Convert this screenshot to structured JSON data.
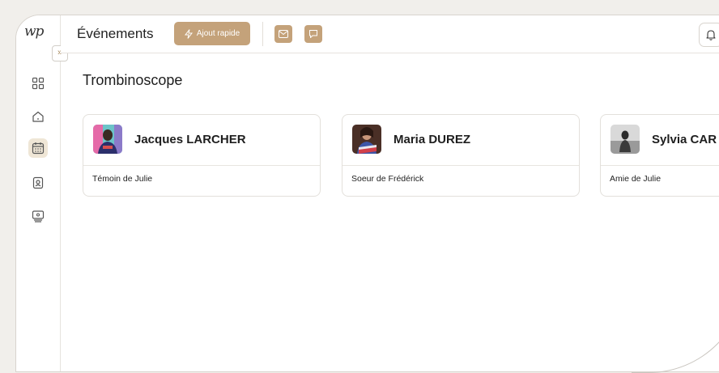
{
  "app": {
    "logo_text": "wp"
  },
  "header": {
    "section_title": "Événements",
    "quick_add_label": "Ajout rapide",
    "quick_add_icon": "lightning-icon",
    "mail_icon": "mail-icon",
    "chat_icon": "chat-icon",
    "bell_icon": "bell-icon"
  },
  "sidebar": {
    "collapse_icon": "double-chevron-right-icon",
    "items": [
      {
        "icon": "dashboard-grid-icon",
        "active": false
      },
      {
        "icon": "home-icon",
        "active": false
      },
      {
        "icon": "calendar-icon",
        "active": true
      },
      {
        "icon": "contact-card-icon",
        "active": false
      },
      {
        "icon": "monitor-icon",
        "active": false
      }
    ]
  },
  "main": {
    "title": "Trombinoscope",
    "people": [
      {
        "name": "Jacques LARCHER",
        "role": "Témoin de Julie"
      },
      {
        "name": "Maria DUREZ",
        "role": "Soeur de Frédérick"
      },
      {
        "name": "Sylvia CAR",
        "role": "Amie de Julie"
      }
    ]
  },
  "colors": {
    "accent": "#c4a27a",
    "active_nav_bg": "#efe6d6",
    "background": "#f1efeb"
  }
}
